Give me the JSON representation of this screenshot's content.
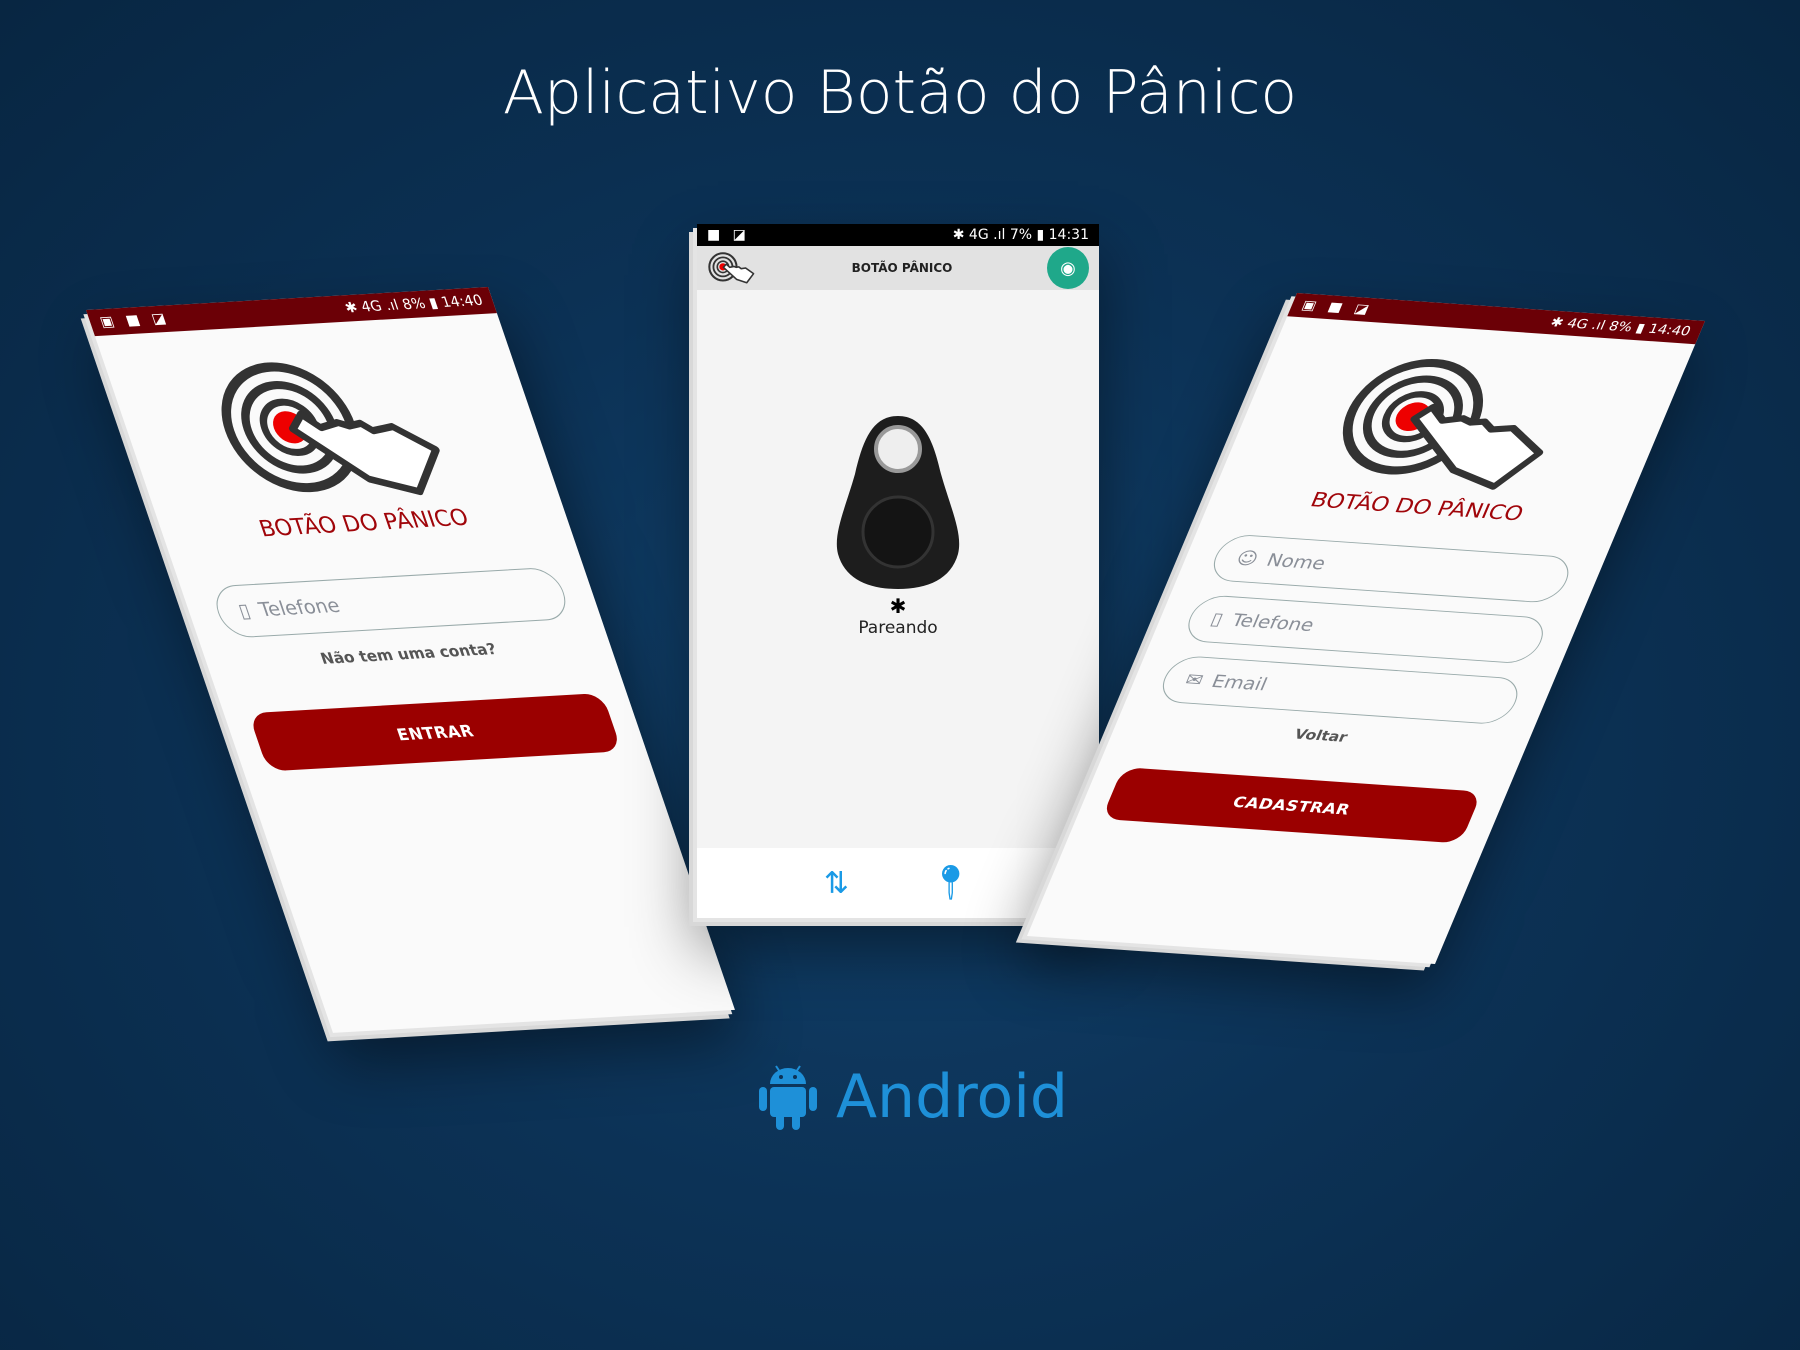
{
  "title": "Aplicativo Botão do Pânico",
  "platform": "Android",
  "left_phone": {
    "status": {
      "battery": "8%",
      "time": "14:40"
    },
    "brand": "BOTÃO DO PÂNICO",
    "phone_placeholder": "Telefone",
    "signup_link": "Não tem uma conta?",
    "enter_button": "ENTRAR"
  },
  "center_phone": {
    "status": {
      "battery": "7%",
      "time": "14:31"
    },
    "app_title": "BOTÃO PÂNICO",
    "pairing_status": "Pareando"
  },
  "right_phone": {
    "status": {
      "battery": "8%",
      "time": "14:40"
    },
    "brand": "BOTÃO DO PÂNICO",
    "name_placeholder": "Nome",
    "phone_placeholder": "Telefone",
    "email_placeholder": "Email",
    "back_link": "Voltar",
    "register_button": "CADASTRAR"
  },
  "colors": {
    "brand_red": "#9b0000",
    "status_bar": "#6b0006",
    "accent_teal": "#1fa88a",
    "android_blue": "#1e90d8"
  }
}
